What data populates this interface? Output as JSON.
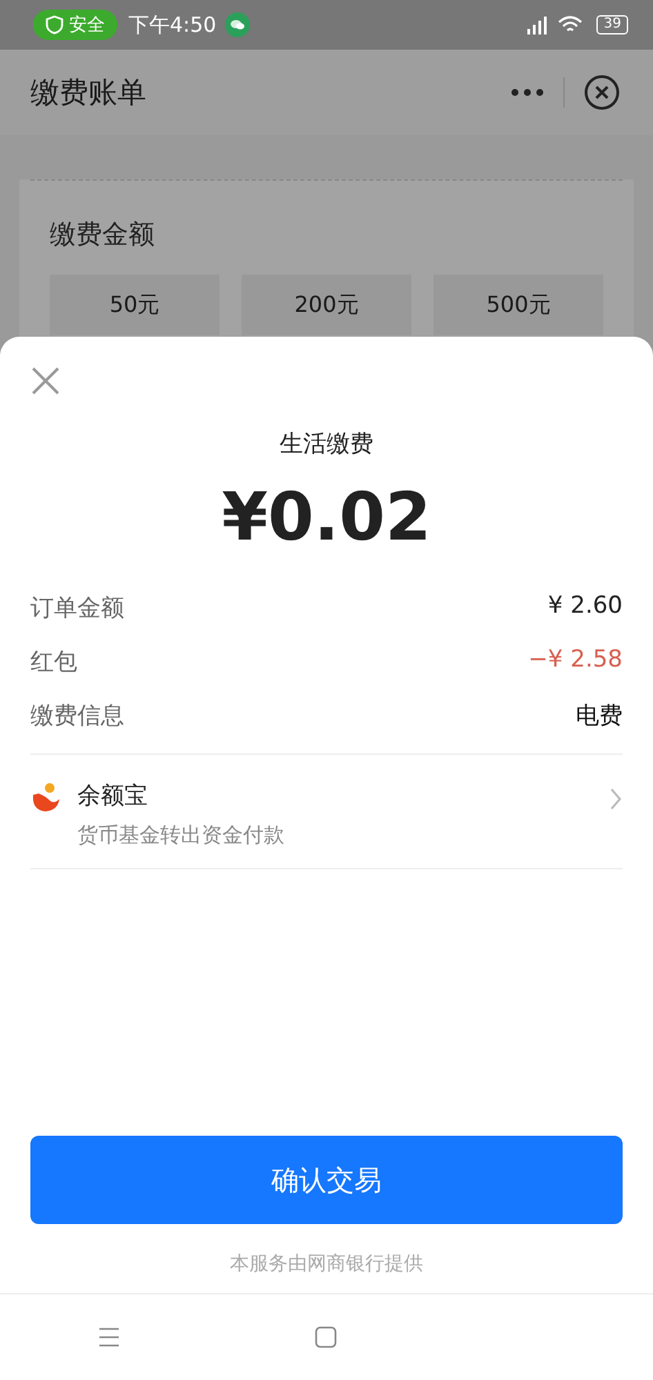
{
  "status_bar": {
    "security_badge": "安全",
    "time": "下午4:50",
    "battery": "39"
  },
  "page": {
    "title": "缴费账单",
    "amount_label": "缴费金额",
    "amount_options": [
      "50元",
      "200元",
      "500元"
    ]
  },
  "payment_sheet": {
    "title": "生活缴费",
    "total": "¥0.02",
    "rows": [
      {
        "label": "订单金额",
        "value": "¥ 2.60",
        "kind": "normal"
      },
      {
        "label": "红包",
        "value": "−¥ 2.58",
        "kind": "discount"
      },
      {
        "label": "缴费信息",
        "value": "电费",
        "kind": "strong"
      }
    ],
    "payment_method": {
      "name": "余额宝",
      "description": "货币基金转出资金付款"
    },
    "confirm_button": "确认交易",
    "footer": "本服务由网商银行提供"
  }
}
